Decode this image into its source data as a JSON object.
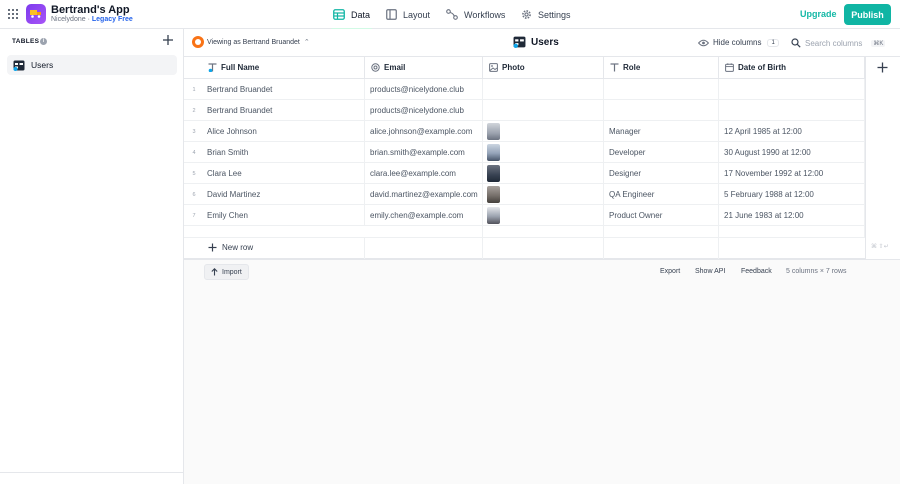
{
  "app": {
    "name": "Bertrand's App",
    "workspace": "Nicelydone",
    "separator": "·",
    "plan": "Legacy Free"
  },
  "nav": {
    "tabs": [
      {
        "label": "Data",
        "icon": "database-icon",
        "active": true
      },
      {
        "label": "Layout",
        "icon": "layout-icon",
        "active": false
      },
      {
        "label": "Workflows",
        "icon": "workflow-icon",
        "active": false
      },
      {
        "label": "Settings",
        "icon": "gear-icon",
        "active": false
      }
    ],
    "upgrade_label": "Upgrade",
    "publish_label": "Publish"
  },
  "sidebar": {
    "tables_label": "TABLES",
    "info_glyph": "i",
    "items": [
      {
        "label": "Users",
        "icon": "table-icon"
      }
    ]
  },
  "gridbar": {
    "viewing_label": "Viewing as Bertrand Bruandet",
    "viewing_chevron": "⌃",
    "title": "Users",
    "hide_columns_label": "Hide columns",
    "hidden_count": "1",
    "search_placeholder": "Search columns",
    "search_shortcut": "⌘K"
  },
  "table": {
    "columns": [
      {
        "label": "Full Name",
        "icon": "text-type-icon"
      },
      {
        "label": "Email",
        "icon": "at-sign-icon"
      },
      {
        "label": "Photo",
        "icon": "image-icon"
      },
      {
        "label": "Role",
        "icon": "text-type-icon"
      },
      {
        "label": "Date of Birth",
        "icon": "calendar-icon"
      }
    ],
    "rows": [
      {
        "num": "1",
        "name": "Bertrand Bruandet",
        "email": "products@nicelydone.club",
        "photo": false,
        "role": "",
        "dob": ""
      },
      {
        "num": "2",
        "name": "Bertrand Bruandet",
        "email": "products@nicelydone.club",
        "photo": false,
        "role": "",
        "dob": ""
      },
      {
        "num": "3",
        "name": "Alice Johnson",
        "email": "alice.johnson@example.com",
        "photo": true,
        "role": "Manager",
        "dob": "12 April 1985 at 12:00"
      },
      {
        "num": "4",
        "name": "Brian Smith",
        "email": "brian.smith@example.com",
        "photo": true,
        "role": "Developer",
        "dob": "30 August 1990 at 12:00"
      },
      {
        "num": "5",
        "name": "Clara Lee",
        "email": "clara.lee@example.com",
        "photo": true,
        "role": "Designer",
        "dob": "17 November 1992 at 12:00"
      },
      {
        "num": "6",
        "name": "David Martinez",
        "email": "david.martinez@example.com",
        "photo": true,
        "role": "QA Engineer",
        "dob": "5 February 1988 at 12:00"
      },
      {
        "num": "7",
        "name": "Emily Chen",
        "email": "emily.chen@example.com",
        "photo": true,
        "role": "Product Owner",
        "dob": "21 June 1983 at 12:00"
      }
    ],
    "new_row_label": "New row",
    "shortcut_hint": "⌘ ⇧↵"
  },
  "footer": {
    "import_label": "Import",
    "export_label": "Export",
    "show_api_label": "Show API",
    "feedback_label": "Feedback",
    "summary": "5 columns × 7 rows"
  },
  "colors": {
    "accent": "#10b5a4",
    "brand_gradient_start": "#7c3aed",
    "brand_gradient_end": "#a855f7",
    "avatar": "#f97316",
    "plan_link": "#2563eb"
  }
}
